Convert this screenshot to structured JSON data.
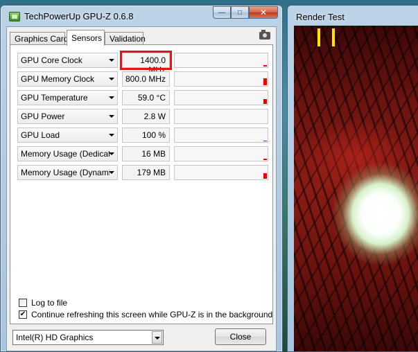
{
  "window": {
    "title": "TechPowerUp GPU-Z 0.6.8"
  },
  "tabs": [
    {
      "label": "Graphics Card"
    },
    {
      "label": "Sensors"
    },
    {
      "label": "Validation"
    }
  ],
  "sensors": [
    {
      "name": "GPU Core Clock",
      "value": "1400.0 MHz",
      "graph_level": 0.1
    },
    {
      "name": "GPU Memory Clock",
      "value": "800.0 MHz",
      "graph_level": 0.5
    },
    {
      "name": "GPU Temperature",
      "value": "59.0 °C",
      "graph_level": 0.35
    },
    {
      "name": "GPU Power",
      "value": "2.8 W",
      "graph_level": 0.0
    },
    {
      "name": "GPU Load",
      "value": "100 %",
      "graph_level": 0.05
    },
    {
      "name": "Memory Usage (Dedicated)",
      "value": "16 MB",
      "graph_level": 0.1
    },
    {
      "name": "Memory Usage (Dynamic)",
      "value": "179 MB",
      "graph_level": 0.4
    }
  ],
  "options": {
    "log_to_file": {
      "label": "Log to file",
      "checked": false
    },
    "refresh_bg": {
      "label": "Continue refreshing this screen while GPU-Z is in the background",
      "checked": true
    }
  },
  "device": {
    "selected": "Intel(R) HD Graphics"
  },
  "buttons": {
    "close": "Close"
  },
  "render": {
    "title": "Render Test"
  },
  "colors": {
    "highlight": "#e0161b",
    "graph_bar": "#ee0000",
    "marker": "#ffe600"
  }
}
